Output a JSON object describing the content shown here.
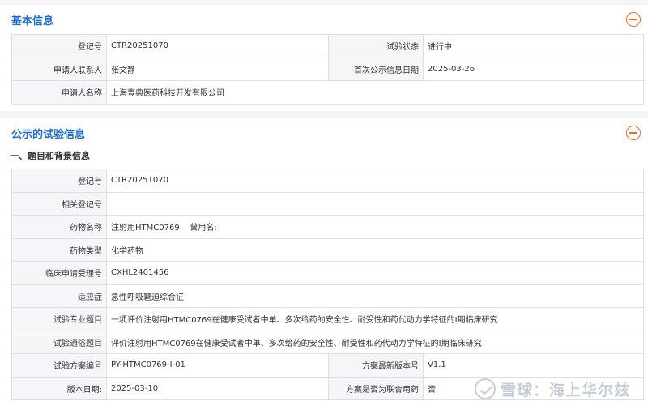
{
  "basic": {
    "title": "基本信息",
    "rows": [
      {
        "l1": "登记号",
        "v1": "CTR20251070",
        "l2": "试验状态",
        "v2": "进行中"
      },
      {
        "l1": "申请人联系人",
        "v1": "张文静",
        "l2": "首次公示信息日期",
        "v2": "2025-03-26"
      },
      {
        "l1": "申请人名称",
        "v1": "上海壹典医药科技开发有限公司"
      }
    ]
  },
  "public": {
    "title": "公示的试验信息",
    "subtitle": "一、题目和背景信息",
    "rows": [
      {
        "label": "登记号",
        "value": "CTR20251070"
      },
      {
        "label": "相关登记号",
        "value": ""
      },
      {
        "label": "药物名称",
        "value": "注射用HTMC0769    曾用名:"
      },
      {
        "label": "药物类型",
        "value": "化学药物"
      },
      {
        "label": "临床申请受理号",
        "value": "CXHL2401456"
      },
      {
        "label": "适应症",
        "value": "急性呼吸窘迫综合征"
      },
      {
        "label": "试验专业题目",
        "value": "一项评价注射用HTMC0769在健康受试者中单、多次给药的安全性、耐受性和药代动力学特征的I期临床研究"
      },
      {
        "label": "试验通俗题目",
        "value": "评价注射用HTMC0769在健康受试者中单、多次给药的安全性、耐受性和药代动力学特征的I期临床研究"
      }
    ],
    "split_rows": [
      {
        "l1": "试验方案编号",
        "v1": "PY-HTMC0769-I-01",
        "l2": "方案最新版本号",
        "v2": "V1.1"
      },
      {
        "l1": "版本日期:",
        "v1": "2025-03-10",
        "l2": "方案是否为联合用药",
        "v2": "否"
      }
    ]
  },
  "watermark": {
    "text": "雪球：海上华尔兹"
  },
  "colors": {
    "accent": "#1f6fc8",
    "collapse": "#f06a1c",
    "label_bg": "#f5f6f8",
    "border": "#dcdfe3"
  }
}
